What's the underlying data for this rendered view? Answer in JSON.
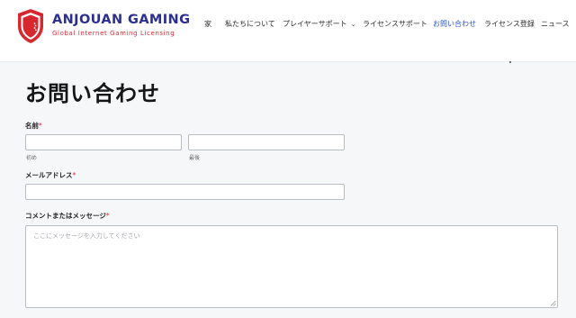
{
  "brand": {
    "name": "ANJOUAN GAMING",
    "tagline": "Global Internet Gaming Licensing",
    "colors": {
      "navy": "#2b2f8f",
      "red": "#d7282f"
    }
  },
  "nav": {
    "items": [
      {
        "label": "家",
        "active": false
      },
      {
        "label": "私たちについて",
        "active": false
      },
      {
        "label": "プレイヤーサポート",
        "active": false,
        "has_dropdown": true
      },
      {
        "label": "ライセンスサポート",
        "active": false
      },
      {
        "label": "お問い合わせ",
        "active": true
      },
      {
        "label": "ライセンス登録",
        "active": false
      },
      {
        "label": "ニュース",
        "active": false
      }
    ],
    "active_color": "#2a56c6"
  },
  "page": {
    "title": "お問い合わせ"
  },
  "form": {
    "name": {
      "label": "名前",
      "required_mark": "*",
      "first_sublabel": "初め",
      "last_sublabel": "最後",
      "first_value": "",
      "last_value": ""
    },
    "email": {
      "label": "メールアドレス",
      "required_mark": "*",
      "value": ""
    },
    "message": {
      "label": "コメントまたはメッセージ",
      "required_mark": "*",
      "placeholder": "ここにメッセージを入力してください",
      "value": ""
    }
  }
}
